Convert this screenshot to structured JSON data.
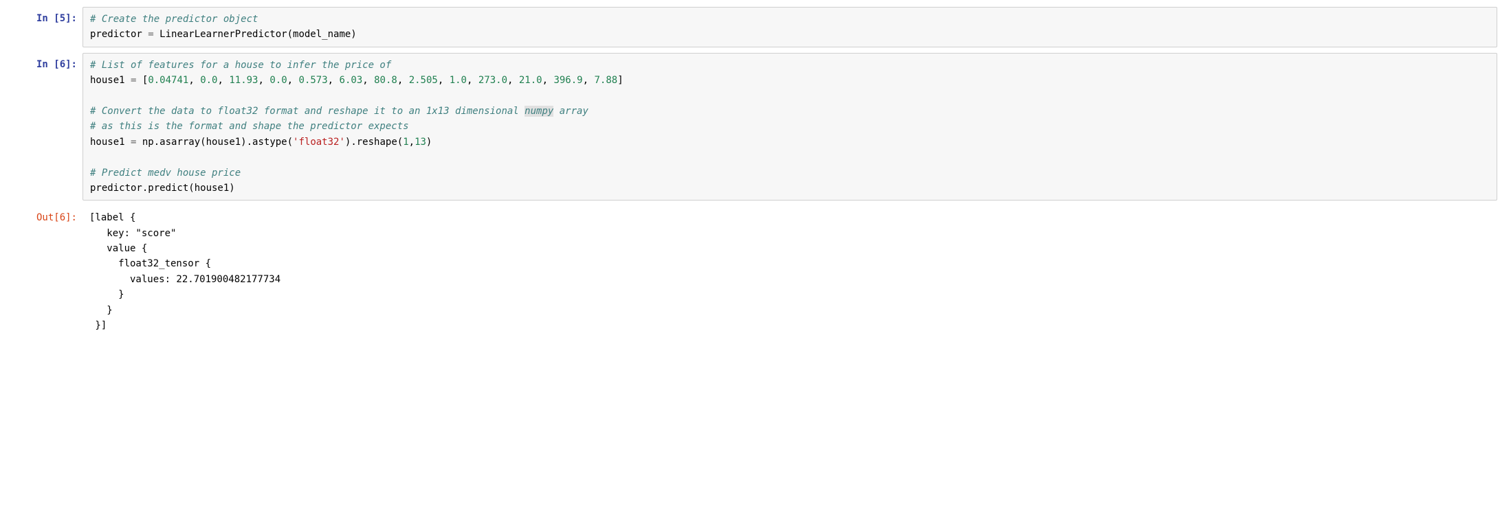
{
  "cells": [
    {
      "prompt": "In [5]:",
      "type": "in",
      "code_html": "<span class='cm'># Create the predictor object</span>\npredictor <span class='op'>=</span> LinearLearnerPredictor(model_name)"
    },
    {
      "prompt": "In [6]:",
      "type": "in",
      "code_html": "<span class='cm'># List of features for a house to infer the price of</span>\nhouse1 <span class='op'>=</span> [<span class='num'>0.04741</span>, <span class='num'>0.0</span>, <span class='num'>11.93</span>, <span class='num'>0.0</span>, <span class='num'>0.573</span>, <span class='num'>6.03</span>, <span class='num'>80.8</span>, <span class='num'>2.505</span>, <span class='num'>1.0</span>, <span class='num'>273.0</span>, <span class='num'>21.0</span>, <span class='num'>396.9</span>, <span class='num'>7.88</span>]\n\n<span class='cm'># Convert the data to float32 format and reshape it to an 1x13 dimensional <span class='hl'>numpy</span> array</span>\n<span class='cm'># as this is the format and shape the predictor expects</span>\nhouse1 <span class='op'>=</span> np.asarray(house1).astype(<span class='str'>'float32'</span>).reshape(<span class='num'>1</span>,<span class='num'>13</span>)\n\n<span class='cm'># Predict medv house price</span>\npredictor.predict(house1)"
    },
    {
      "prompt": "Out[6]:",
      "type": "out",
      "text": "[label {\n   key: \"score\"\n   value {\n     float32_tensor {\n       values: 22.701900482177734\n     }\n   }\n }]"
    }
  ]
}
